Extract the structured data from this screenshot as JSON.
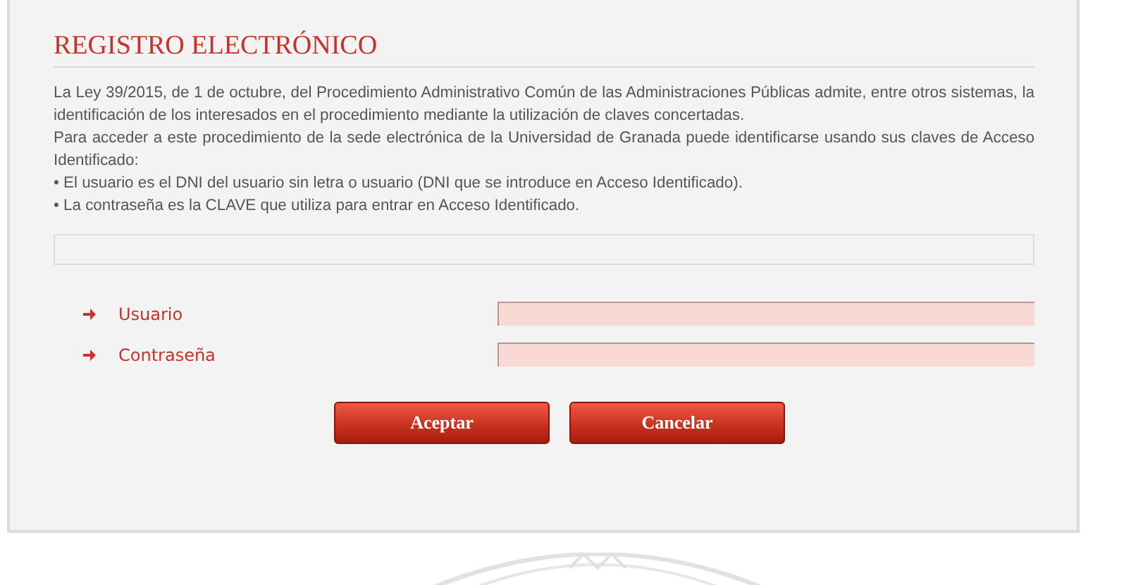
{
  "title": "REGISTRO ELECTRÓNICO",
  "paragraphs": [
    "La Ley 39/2015, de 1 de octubre, del Procedimiento Administrativo Común de las Administraciones Públicas admite, entre otros sistemas, la identificación de los interesados en el procedimiento mediante la utilización de claves concertadas.",
    "Para acceder a este procedimiento de la sede electrónica de la Universidad de Granada puede identificarse usando sus claves de Acceso Identificado:",
    "• El usuario es el DNI del usuario sin letra o usuario (DNI que se introduce en Acceso Identificado).",
    "• La contraseña es la CLAVE que utiliza para entrar en Acceso Identificado."
  ],
  "fields": [
    {
      "label": "Usuario"
    },
    {
      "label": "Contraseña"
    }
  ],
  "buttons": [
    "Aceptar",
    "Cancelar"
  ]
}
